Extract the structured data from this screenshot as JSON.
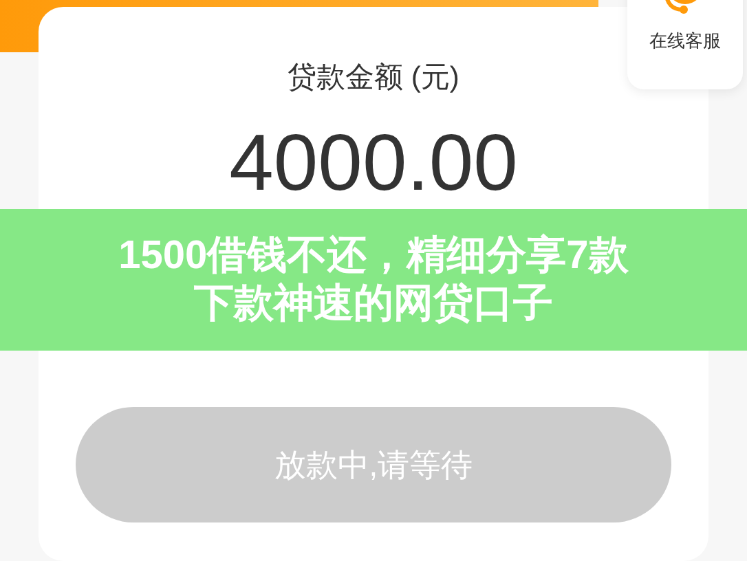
{
  "service": {
    "label": "在线客服"
  },
  "loan": {
    "label": "贷款金额 (元)",
    "amount": "4000.00"
  },
  "banner": {
    "title": "1500借钱不还，精细分享7款下款神速的网贷口子"
  },
  "submit": {
    "label": "放款中,请等待",
    "disabled": true
  }
}
